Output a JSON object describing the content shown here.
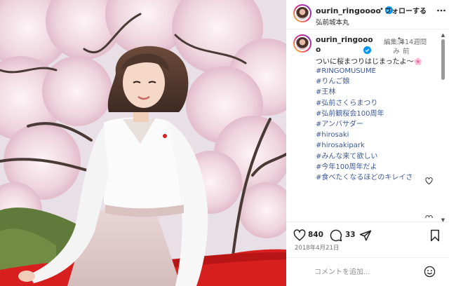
{
  "post": {
    "photo_alt": "",
    "header": {
      "username": "ourin_ringoooo",
      "location": "弘前城本丸",
      "separator": "•",
      "follow_label": "フォローする"
    },
    "caption": {
      "username_line1": "ourin_ringooo",
      "username_line2": "o",
      "edited_line1": "編集済",
      "edited_line2": "み",
      "separator": "•",
      "age_line1": "414週間",
      "age_line2": "前",
      "first_line": "ついに桜まつりはじまったよ〜🌸",
      "hashtags": [
        "#RINGOMUSUME",
        "#りんご娘",
        "#王林",
        "#弘前さくらまつり",
        "#弘前観桜会100周年",
        "#アンバサダー",
        "#hirosaki",
        "#hirosakipark",
        "#みんな来て欲しい",
        "#今年100周年だよ",
        "#食べたくなるほどのキレイさ"
      ]
    },
    "likes_count": "840",
    "comments_count": "33",
    "date": "2018年4月21日",
    "comment_placeholder": "コメントを追加...",
    "icons": {
      "verified": "verified-badge-icon",
      "more": "more-options-icon",
      "like": "heart-icon",
      "comment": "comment-icon",
      "share": "share-icon",
      "save": "bookmark-icon",
      "emoji": "emoji-icon"
    },
    "colors": {
      "verified_blue": "#0095f6",
      "hashtag_blue": "#3b5998",
      "carpet_red": "#d81f1f"
    }
  }
}
